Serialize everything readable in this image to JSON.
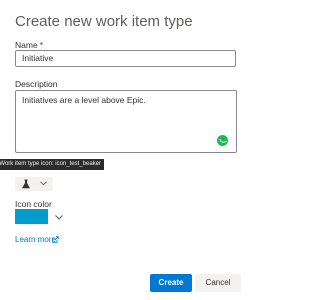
{
  "dialog": {
    "title": "Create new work item type",
    "name": {
      "label": "Name",
      "required_mark": "*",
      "value": "Initiative"
    },
    "description": {
      "label": "Description",
      "value": "Initiatives are a level above Epic."
    },
    "icon_picker": {
      "tooltip": "Work item type icon: icon_test_beaker",
      "selected_icon": "beaker-icon"
    },
    "icon_color": {
      "label": "Icon color",
      "value_hex": "#009ccc"
    },
    "learn_more": "Learn more",
    "buttons": {
      "create": "Create",
      "cancel": "Cancel"
    },
    "colors": {
      "primary": "#0078d4",
      "grammar_badge": "#1db954"
    }
  }
}
